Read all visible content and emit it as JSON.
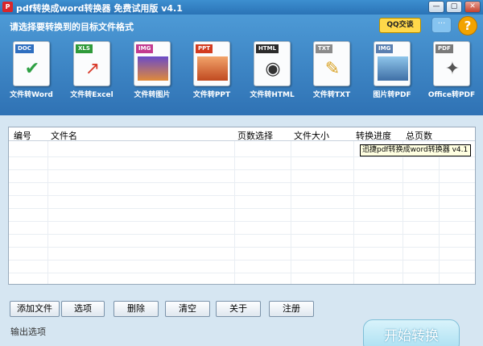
{
  "window": {
    "title": "pdf转换成word转换器 免费试用版 v4.1",
    "buttons": {
      "minimize": "—",
      "restore": "▢",
      "close": "✕"
    }
  },
  "header": {
    "instruction": "请选择要转换到的目标文件格式",
    "qq_label": "QQ交谈",
    "chat_glyph": "···",
    "help_glyph": "?"
  },
  "formats": [
    {
      "tag": "DOC",
      "label": "文件转Word",
      "tag_color": "#2f6fc0",
      "icon": "word-doc-icon"
    },
    {
      "tag": "XLS",
      "label": "文件转Excel",
      "tag_color": "#2f9a3a",
      "icon": "excel-chart-icon"
    },
    {
      "tag": "IMG",
      "label": "文件转图片",
      "tag_color": "#c23a8f",
      "icon": "image-icon"
    },
    {
      "tag": "PPT",
      "label": "文件转PPT",
      "tag_color": "#d23b20",
      "icon": "ppt-icon"
    },
    {
      "tag": "HTML",
      "label": "文件转HTML",
      "tag_color": "#2b2b2b",
      "icon": "html-globe-icon"
    },
    {
      "tag": "TXT",
      "label": "文件转TXT",
      "tag_color": "#8b8b8b",
      "icon": "txt-icon"
    },
    {
      "tag": "IMG",
      "label": "图片转PDF",
      "tag_color": "#5a7fb0",
      "icon": "image-to-pdf-icon"
    },
    {
      "tag": "PDF",
      "label": "Office转PDF",
      "tag_color": "#7a7a7a",
      "icon": "pdf-icon"
    }
  ],
  "table": {
    "columns": [
      "编号",
      "文件名",
      "页数选择",
      "文件大小",
      "转换进度",
      "总页数"
    ],
    "tooltip": "迅捷pdf转换成word转换器 v4.1"
  },
  "buttons": {
    "add_file": "添加文件",
    "options": "选项",
    "delete": "删除",
    "clear": "清空",
    "about": "关于",
    "register": "注册"
  },
  "footer": {
    "output_label": "输出选项",
    "start_label": "开始转换"
  }
}
